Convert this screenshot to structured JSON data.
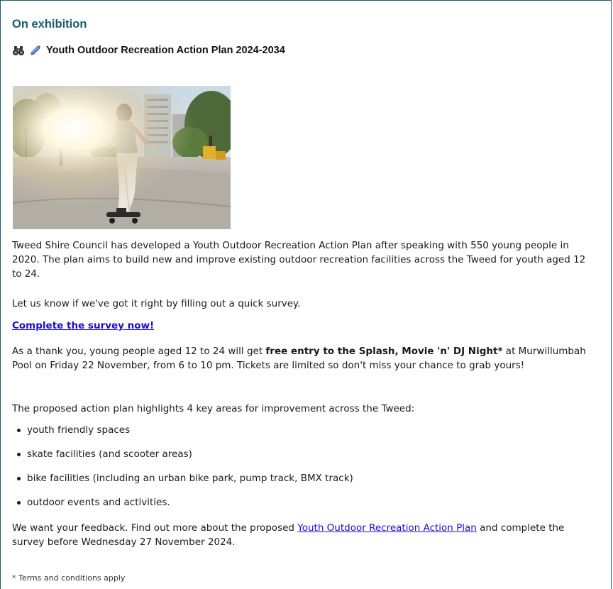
{
  "section": {
    "title": "On exhibition"
  },
  "plan": {
    "icons": [
      "binoculars-icon",
      "skateboard-icon"
    ],
    "title": "Youth Outdoor Recreation Action Plan 2024-2034"
  },
  "hero_image": {
    "description": "Skater on a skateboard at an outdoor skate park with trees and high-rise buildings, sun glare"
  },
  "paragraphs": {
    "intro": "Tweed Shire Council has developed a Youth Outdoor Recreation Action Plan after speaking with 550 young people in 2020. The plan aims to build new and improve existing outdoor recreation facilities across the Tweed for youth aged 12 to 24.",
    "survey_prompt": "Let us know if we've got it right by filling out a quick survey.",
    "survey_link": "Complete the survey now!",
    "thanks_before": "As a thank you, young people aged 12 to 24 will get ",
    "thanks_bold": "free entry to the Splash, Movie 'n' DJ Night*",
    "thanks_after": " at Murwillumbah Pool on Friday 22 November, from 6 to 10 pm. Tickets are limited so don't miss your chance to grab yours!",
    "areas_intro": "The proposed action plan highlights 4 key areas for improvement across the Tweed:",
    "feedback_before": "We want your feedback. Find out more about the proposed ",
    "feedback_link": "Youth Outdoor Recreation Action Plan",
    "feedback_after": " and complete the survey before Wednesday 27 November 2024.",
    "terms": "* Terms and conditions apply"
  },
  "areas": [
    "youth friendly spaces",
    "skate facilities (and scooter areas)",
    "bike facilities (including an urban bike park, pump track, BMX track)",
    "outdoor events and activities."
  ]
}
